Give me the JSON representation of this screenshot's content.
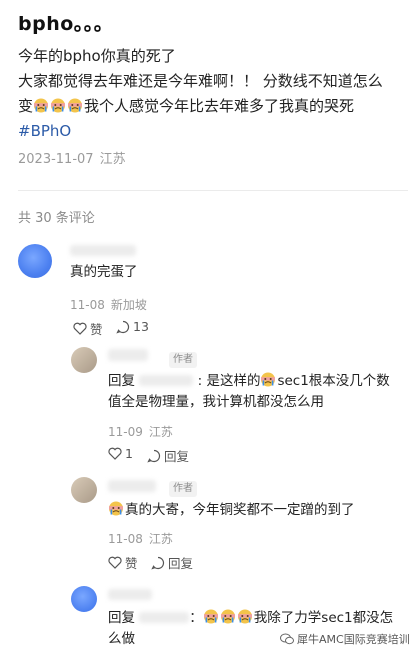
{
  "post": {
    "title": "bpho。。。",
    "line1": "今年的bpho你真的死了",
    "line2": "大家都觉得去年难还是今年难啊！！ 分数线不知道怎么",
    "line3_pre": "变",
    "line3_post": "我个人感觉今年比去年难多了我真的哭死",
    "hashtag": "#BPhO",
    "date": "2023-11-07",
    "location": "江苏"
  },
  "comments_header": {
    "count_text": "共 30 条评论"
  },
  "emoji_icon": "crying-face-icon",
  "comments": [
    {
      "text": "真的完蛋了",
      "date": "11-08",
      "location": "新加坡",
      "like_label": "赞",
      "reply_count": "13",
      "avatar_color": "#5b8ef5"
    }
  ],
  "replies": [
    {
      "author_tag": "作者",
      "reply_prefix": "回复",
      "sep": ":",
      "text_a": "是这样的",
      "text_b": "sec1根本没几个数",
      "text_c": "值全是物理量，我计算机都没怎么用",
      "date": "11-09",
      "location": "江苏",
      "like_count": "1",
      "reply_label": "回复"
    },
    {
      "author_tag": "作者",
      "text_b": "真的大寄，今年铜奖都不一定蹭的到了",
      "date": "11-08",
      "location": "江苏",
      "like_label": "赞",
      "reply_label": "回复"
    },
    {
      "reply_prefix": "回复",
      "sep": "：",
      "text_b": "我除了力学sec1都没怎",
      "text_c": "么做"
    }
  ],
  "watermark": {
    "text": "犀牛AMC国际竞赛培训"
  },
  "colors": {
    "hashtag": "#2c5ba8",
    "meta": "#9a9a9a",
    "avatar_blue": "#5b8ef5"
  }
}
